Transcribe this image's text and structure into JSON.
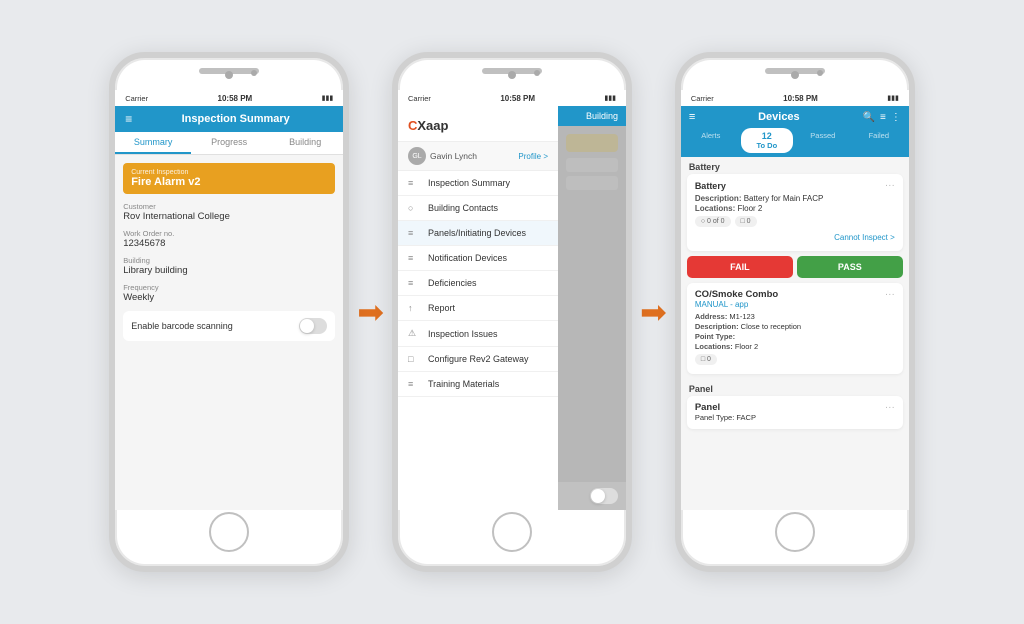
{
  "scene": {
    "bg_color": "#e8eaed"
  },
  "phone1": {
    "status": {
      "carrier": "Carrier",
      "wifi": "▶",
      "time": "10:58 PM",
      "battery": "▮▮▮"
    },
    "header": {
      "title": "Inspection Summary",
      "menu_icon": "≡"
    },
    "tabs": [
      "Summary",
      "Progress",
      "Building"
    ],
    "active_tab": "Summary",
    "current_inspection_label": "Current Inspection",
    "current_inspection_value": "Fire Alarm v2",
    "fields": [
      {
        "label": "Customer",
        "value": "Rov International College"
      },
      {
        "label": "Work Order no.",
        "value": "12345678"
      },
      {
        "label": "Building",
        "value": "Library building"
      },
      {
        "label": "Frequency",
        "value": "Weekly"
      }
    ],
    "toggle_label": "Enable barcode scanning"
  },
  "phone2": {
    "status": {
      "carrier": "Carrier",
      "wifi": "▶",
      "time": "10:58 PM",
      "battery": "▮▮▮"
    },
    "logo": "CXaap",
    "profile_label": "Profile",
    "user_name": "Gavin Lynch",
    "overlay_tab": "Building",
    "menu_items": [
      {
        "icon": "≡",
        "label": "Inspection Summary"
      },
      {
        "icon": "○",
        "label": "Building Contacts"
      },
      {
        "icon": "≡",
        "label": "Panels/Initiating Devices"
      },
      {
        "icon": "≡",
        "label": "Notification Devices"
      },
      {
        "icon": "≡",
        "label": "Deficiencies"
      },
      {
        "icon": "↑",
        "label": "Report"
      },
      {
        "icon": "⚠",
        "label": "Inspection Issues"
      },
      {
        "icon": "□",
        "label": "Configure Rev2 Gateway"
      },
      {
        "icon": "≡",
        "label": "Training Materials"
      }
    ]
  },
  "phone3": {
    "status": {
      "carrier": "Carrier",
      "wifi": "▶",
      "time": "10:58 PM",
      "battery": "▮▮▮"
    },
    "header": {
      "title": "Devices",
      "menu_icon": "≡"
    },
    "tabs": [
      {
        "label": "Alerts",
        "count": null,
        "active": false
      },
      {
        "label": "To Do",
        "count": "12",
        "active": true
      },
      {
        "label": "Passed",
        "count": null,
        "active": false
      },
      {
        "label": "Failed",
        "count": null,
        "active": false
      }
    ],
    "battery_section": "Battery",
    "battery_card": {
      "title": "Battery",
      "desc_label": "Description:",
      "desc_value": "Battery for Main FACP",
      "loc_label": "Locations:",
      "loc_value": "Floor 2",
      "cannot_inspect": "Cannot Inspect"
    },
    "fail_label": "FAIL",
    "pass_label": "PASS",
    "device_card": {
      "name": "CO/Smoke Combo",
      "subtitle": "MANUAL - app",
      "address_label": "Address:",
      "address_value": "M1-123",
      "desc_label": "Description:",
      "desc_value": "Close to reception",
      "point_type_label": "Point Type:",
      "loc_label": "Locations:",
      "loc_value": "Floor 2"
    },
    "panel_section": "Panel",
    "panel_subtitle": "Panel Type: FACP"
  },
  "arrows": [
    "→",
    "→"
  ]
}
